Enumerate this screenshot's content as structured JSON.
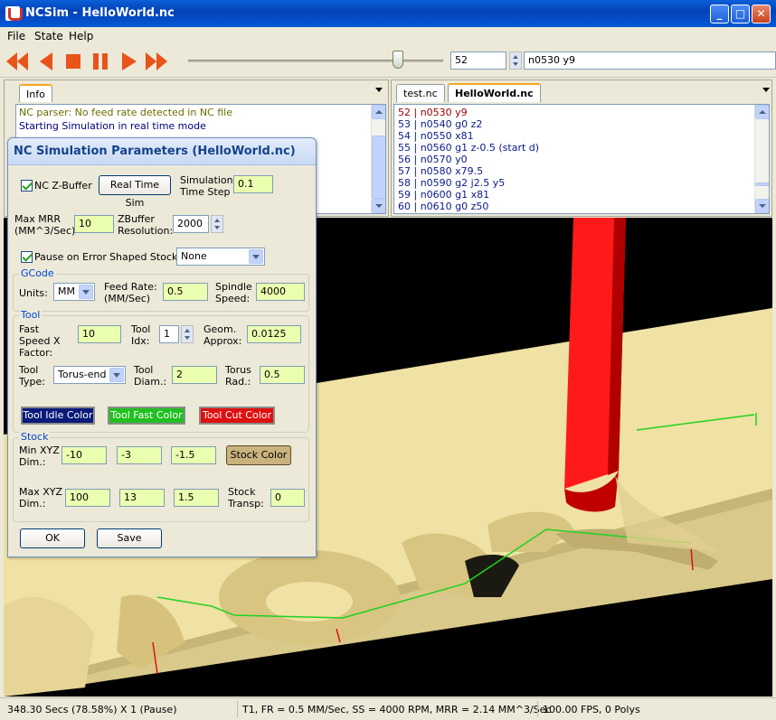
{
  "window": {
    "title": "NCSim - HelloWorld.nc"
  },
  "menu": [
    "File",
    "State",
    "Help"
  ],
  "toolbar": {
    "line_number": "52",
    "current_line": "n0530 y9"
  },
  "info_panel": {
    "tab": "Info",
    "lines": [
      "NC parser: No feed rate detected in NC file",
      "Starting Simulation in real time mode"
    ]
  },
  "code_panel": {
    "tabs": [
      "test.nc",
      "HelloWorld.nc"
    ],
    "lines": [
      {
        "num": "52",
        "text": "n0530 y9"
      },
      {
        "num": "53",
        "text": "n0540 g0 z2"
      },
      {
        "num": "54",
        "text": "n0550 x81"
      },
      {
        "num": "55",
        "text": "n0560 g1 z-0.5 (start d)"
      },
      {
        "num": "56",
        "text": "n0570 y0"
      },
      {
        "num": "57",
        "text": "n0580 x79.5"
      },
      {
        "num": "58",
        "text": "n0590 g2 j2.5 y5"
      },
      {
        "num": "59",
        "text": "n0600 g1 x81"
      },
      {
        "num": "60",
        "text": "n0610 g0 z50"
      }
    ]
  },
  "dialog": {
    "title": "NC Simulation Parameters (HelloWorld.nc)",
    "nc_zbuffer_label": "NC Z-Buffer",
    "realtime_button": "Real Time Sim",
    "sim_time_step_label": "Simulation Time Step",
    "sim_time_step": "0.1",
    "max_mrr_label": "Max MRR (MM^3/Sec)",
    "max_mrr": "10",
    "zbuffer_res_label": "ZBuffer Resolution:",
    "zbuffer_res": "2000",
    "pause_on_error_label": "Pause on Error",
    "shaped_stock_label": "Shaped Stock:",
    "shaped_stock": "None",
    "gcode": {
      "group": "GCode",
      "units_label": "Units:",
      "units": "MM",
      "feed_rate_label": "Feed Rate: (MM/Sec)",
      "feed_rate": "0.5",
      "spindle_label": "Spindle Speed:",
      "spindle": "4000"
    },
    "tool": {
      "group": "Tool",
      "fast_speed_label": "Fast Speed X Factor:",
      "fast_speed": "10",
      "idx_label": "Tool Idx:",
      "idx": "1",
      "geom_label": "Geom. Approx:",
      "geom": "0.0125",
      "type_label": "Tool Type:",
      "type": "Torus-end",
      "diam_label": "Tool Diam.:",
      "diam": "2",
      "torus_label": "Torus Rad.:",
      "torus": "0.5",
      "idle_color": "Tool Idle Color",
      "fast_color": "Tool Fast Color",
      "cut_color": "Tool Cut Color"
    },
    "stock": {
      "group": "Stock",
      "min_label": "Min XYZ Dim.:",
      "min": [
        "-10",
        "-3",
        "-1.5"
      ],
      "color_button": "Stock Color",
      "max_label": "Max XYZ Dim.:",
      "max": [
        "100",
        "13",
        "1.5"
      ],
      "transp_label": "Stock Transp:",
      "transp": "0"
    },
    "ok": "OK",
    "save": "Save"
  },
  "status": {
    "time": "348.30 Secs (78.58%) X 1 (Pause)",
    "tool": "T1, FR = 0.5 MM/Sec, SS = 4000 RPM, MRR = 2.14 MM^3/Sec",
    "fps": "100.00 FPS, 0 Polys"
  },
  "colors": {
    "stock": "#efe2a4",
    "tool": "#ff0000",
    "idle": "#0a1a7a",
    "fast": "#20c020",
    "cut": "#e01010"
  }
}
